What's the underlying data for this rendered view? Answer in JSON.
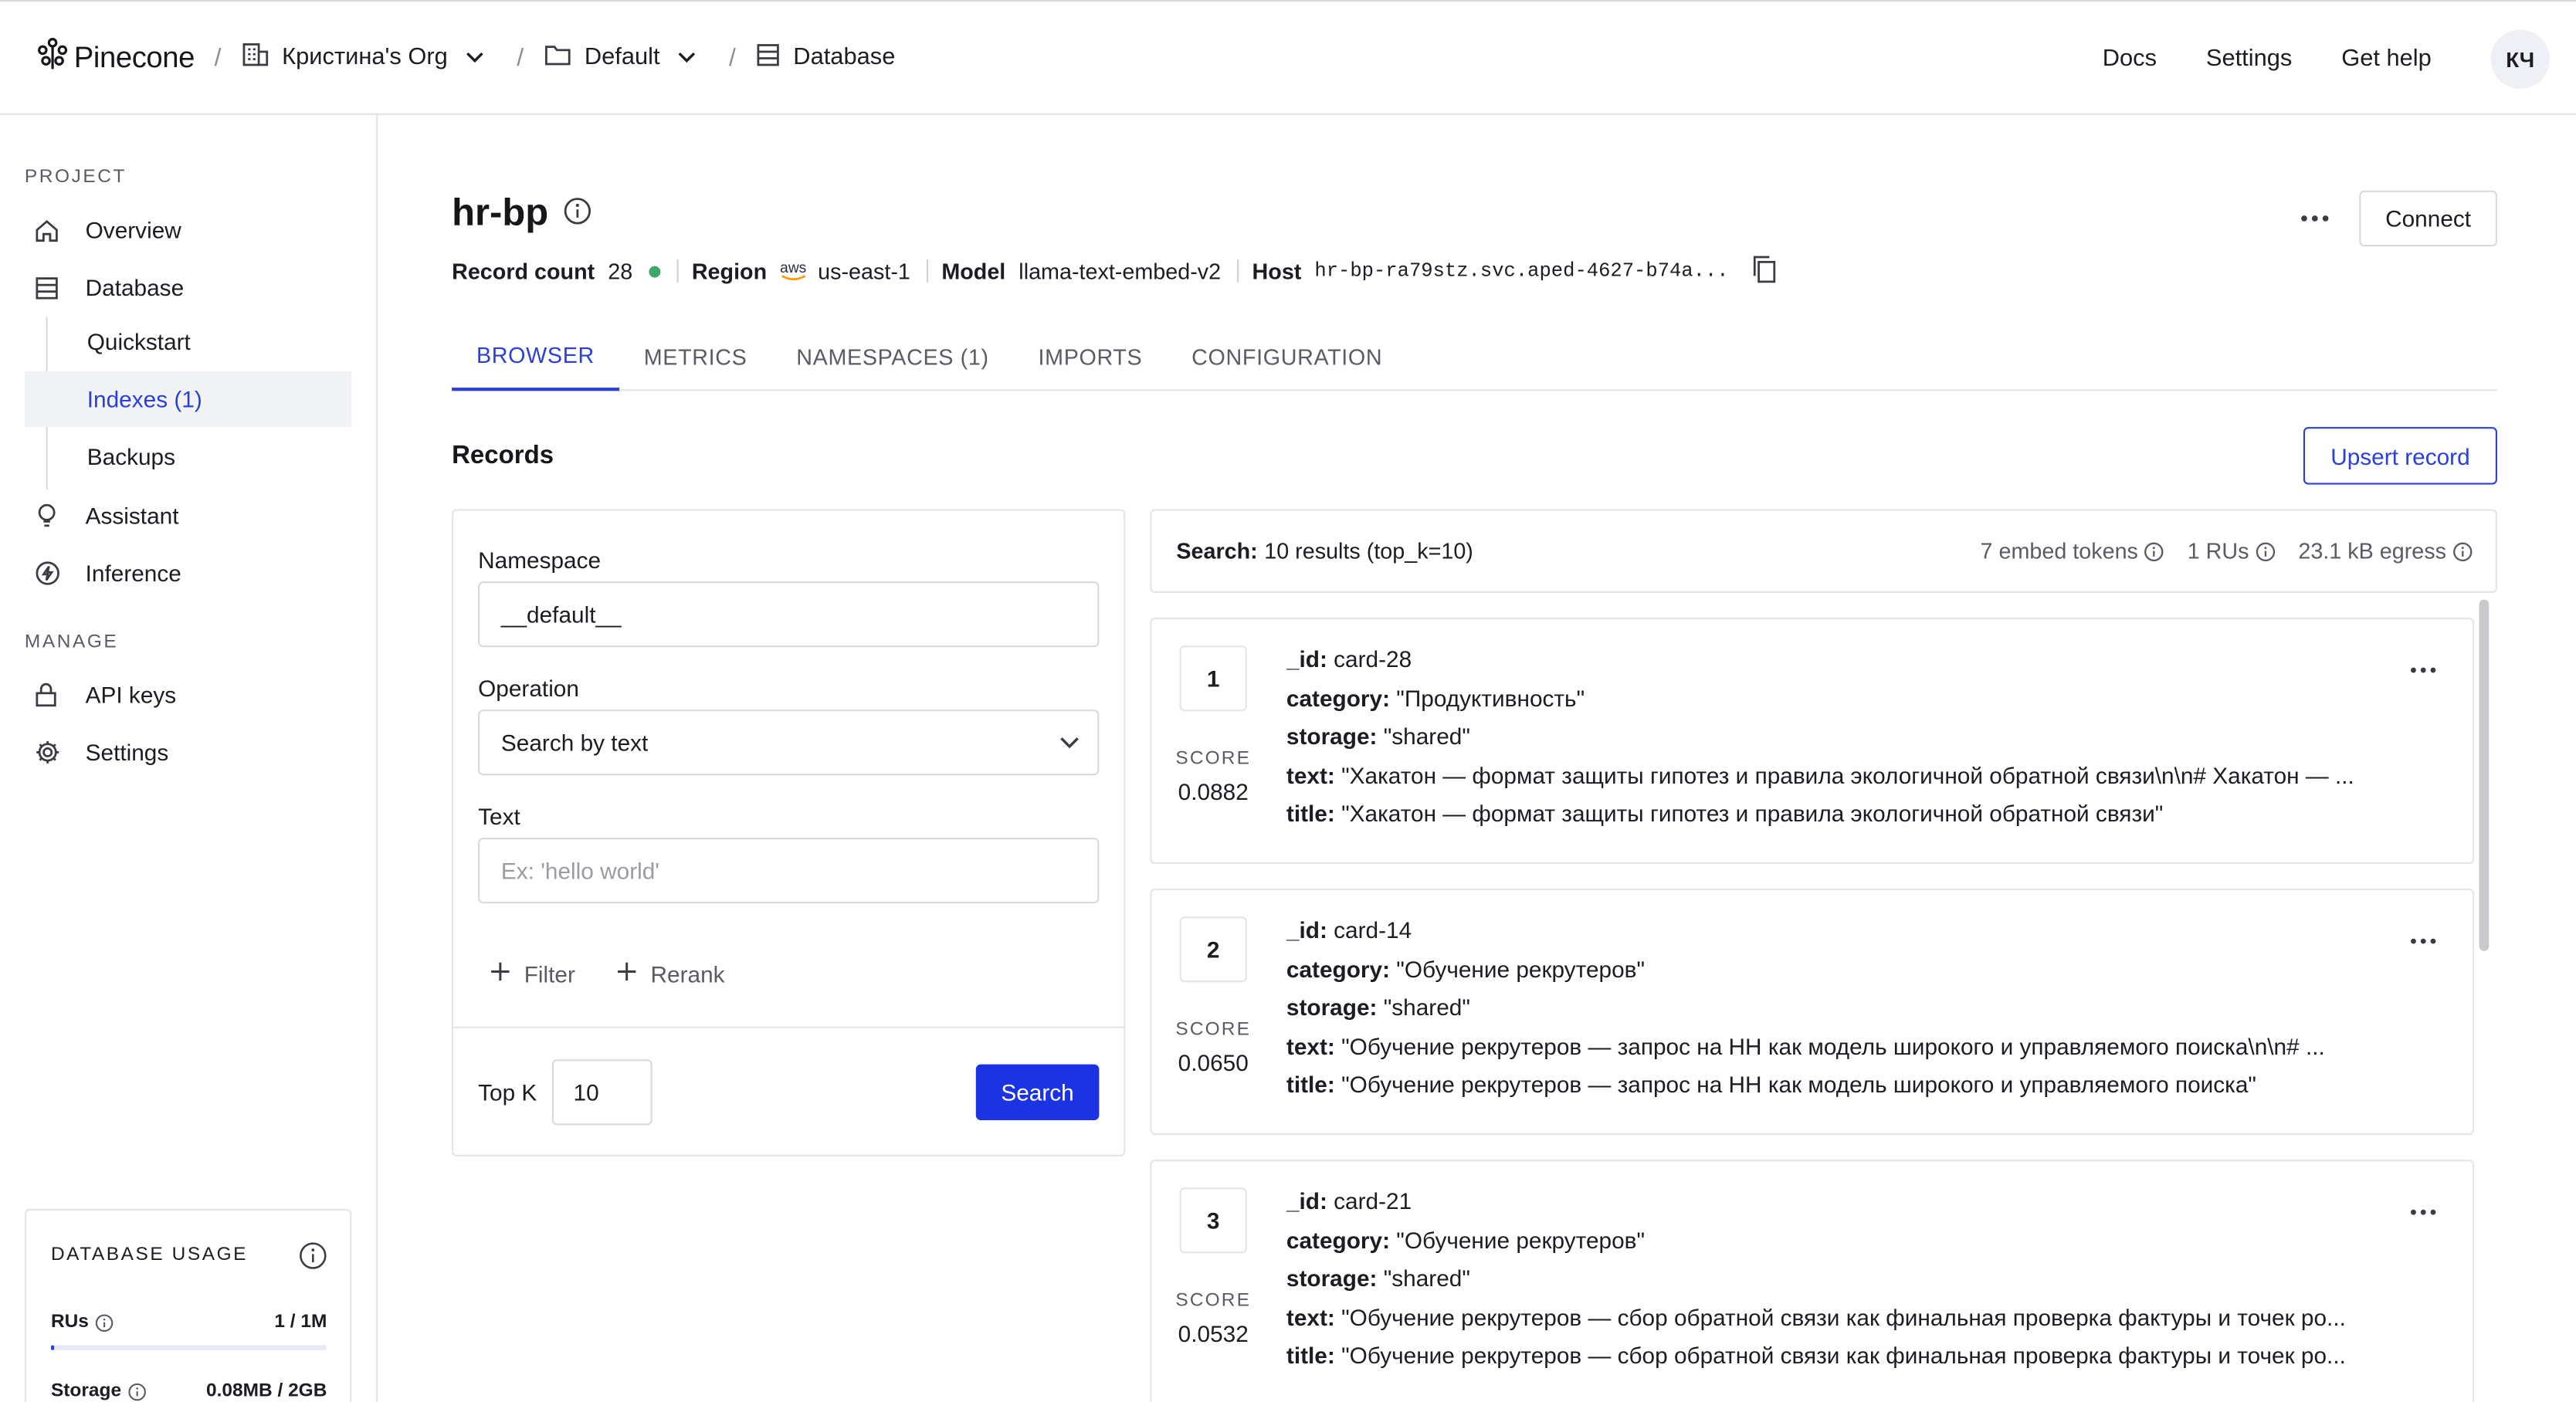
{
  "header": {
    "logo_text": "Pinecone",
    "breadcrumbs": [
      {
        "label": "Кристина's Org"
      },
      {
        "label": "Default"
      },
      {
        "label": "Database"
      }
    ],
    "nav": [
      "Docs",
      "Settings",
      "Get help"
    ],
    "avatar_initials": "КЧ"
  },
  "sidebar": {
    "project_label": "PROJECT",
    "items": [
      {
        "label": "Overview"
      },
      {
        "label": "Database"
      },
      {
        "label": "Quickstart"
      },
      {
        "label": "Indexes (1)"
      },
      {
        "label": "Backups"
      },
      {
        "label": "Assistant"
      },
      {
        "label": "Inference"
      }
    ],
    "manage_label": "MANAGE",
    "manage_items": [
      {
        "label": "API keys"
      },
      {
        "label": "Settings"
      }
    ],
    "usage": {
      "title": "DATABASE USAGE",
      "rus_label": "RUs",
      "rus_value": "1 / 1M",
      "rus_fraction": 0.001,
      "storage_label": "Storage",
      "storage_value": "0.08MB / 2GB"
    }
  },
  "index": {
    "name": "hr-bp",
    "record_count_label": "Record count",
    "record_count": "28",
    "region_label": "Region",
    "provider": "aws",
    "region": "us-east-1",
    "model_label": "Model",
    "model": "llama-text-embed-v2",
    "host_label": "Host",
    "host": "hr-bp-ra79stz.svc.aped-4627-b74a...",
    "connect_label": "Connect"
  },
  "tabs": [
    {
      "label": "BROWSER",
      "active": true
    },
    {
      "label": "METRICS"
    },
    {
      "label": "NAMESPACES (1)"
    },
    {
      "label": "IMPORTS"
    },
    {
      "label": "CONFIGURATION"
    }
  ],
  "records": {
    "heading": "Records",
    "upsert_label": "Upsert record"
  },
  "form": {
    "namespace_label": "Namespace",
    "namespace_value": "__default__",
    "operation_label": "Operation",
    "operation_value": "Search by text",
    "text_label": "Text",
    "text_placeholder": "Ex: 'hello world'",
    "filter_label": "Filter",
    "rerank_label": "Rerank",
    "topk_label": "Top K",
    "topk_value": "10",
    "search_label": "Search"
  },
  "results": {
    "summary_label": "Search:",
    "summary_value": "10 results (top_k=10)",
    "embed_tokens": "7 embed tokens",
    "rus": "1 RUs",
    "egress": "23.1 kB egress",
    "score_label": "SCORE",
    "items": [
      {
        "rank": "1",
        "score": "0.0882",
        "id": "card-28",
        "category": "\"Продуктивность\"",
        "storage": "\"shared\"",
        "text": "\"Хакатон — формат защиты гипотез и правила экологичной обратной связи\\n\\n# Хакатон — ...",
        "title": "\"Хакатон — формат защиты гипотез и правила экологичной обратной связи\""
      },
      {
        "rank": "2",
        "score": "0.0650",
        "id": "card-14",
        "category": "\"Обучение рекрутеров\"",
        "storage": "\"shared\"",
        "text": "\"Обучение рекрутеров — запрос на НН как модель широкого и управляемого поиска\\n\\n# ...",
        "title": "\"Обучение рекрутеров — запрос на НН как модель широкого и управляемого поиска\""
      },
      {
        "rank": "3",
        "score": "0.0532",
        "id": "card-21",
        "category": "\"Обучение рекрутеров\"",
        "storage": "\"shared\"",
        "text": "\"Обучение рекрутеров — сбор обратной связи как финальная проверка фактуры и точек ро...",
        "title": "\"Обучение рекрутеров — сбор обратной связи как финальная проверка фактуры и точек ро..."
      }
    ],
    "field_labels": {
      "id": "_id:",
      "category": "category:",
      "storage": "storage:",
      "text": "text:",
      "title": "title:"
    }
  },
  "colors": {
    "accent": "#2a40d6",
    "primary_button": "#1c33e3",
    "status_ready": "#3fa76b"
  }
}
